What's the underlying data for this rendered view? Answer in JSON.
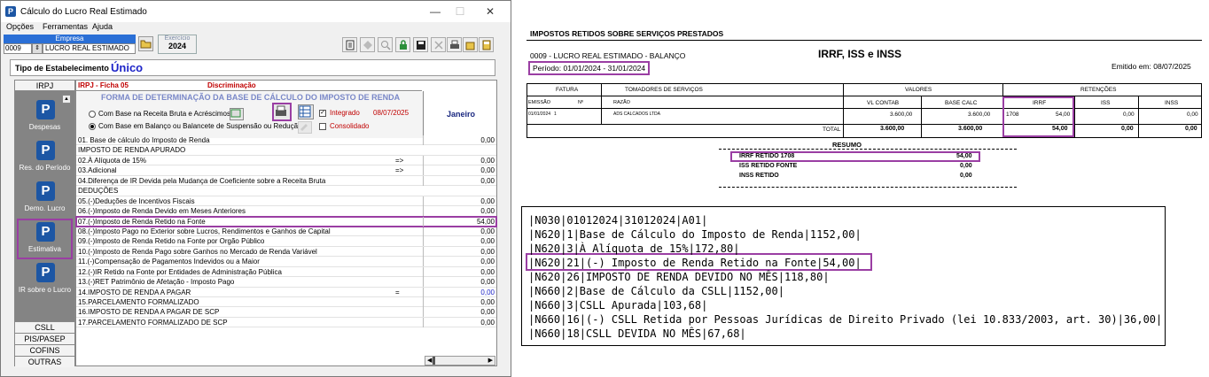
{
  "window": {
    "title": "Cálculo do Lucro Real Estimado",
    "controls": [
      "—",
      "☐",
      "✕"
    ]
  },
  "menu": [
    "Opções",
    "Ferramentas",
    "Ajuda"
  ],
  "empresa": {
    "label": "Empresa",
    "code": "0009",
    "name": "LUCRO REAL ESTIMADO"
  },
  "exercicio": {
    "label": "Exercício",
    "value": "2024"
  },
  "tipo": {
    "label": "Tipo de Estabelecimento",
    "value": "Único"
  },
  "sidebar": {
    "header": "IRPJ",
    "items": [
      {
        "label": "Despesas"
      },
      {
        "label": "Res. do Período"
      },
      {
        "label": "Demo. Lucro"
      },
      {
        "label": "Estimativa"
      },
      {
        "label": "IR sobre o Lucro"
      }
    ],
    "bottom": [
      "CSLL",
      "PIS/PASEP",
      "COFINS",
      "OUTRAS"
    ]
  },
  "main": {
    "ficha": "IRPJ - Ficha 05",
    "discriminacao": "Discriminação",
    "forma_title": "FORMA DE DETERMINAÇÃO DA BASE DE CÁLCULO DO IMPOSTO DE RENDA",
    "opt1": "Com Base na  Receita Bruta e Acréscimos",
    "opt2": "Com Base em Balanço ou Balancete de Suspensão ou Redução",
    "integrado": "Integrado",
    "date": "08/07/2025",
    "consolidado": "Consolidado",
    "month": "Janeiro",
    "rows": [
      {
        "label": "01. Base de cálculo do Imposto de Renda",
        "mark": "",
        "value": "0,00"
      },
      {
        "label": "IMPOSTO DE RENDA APURADO",
        "mark": "",
        "value": ""
      },
      {
        "label": "   02.À  Alíquota de 15%",
        "mark": "=>",
        "value": "0,00"
      },
      {
        "label": "   03.Adicional",
        "mark": "=>",
        "value": "0,00"
      },
      {
        "label": "   04.Diferença de IR Devida pela Mudança de Coeficiente sobre a Receita Bruta",
        "mark": "",
        "value": "0,00"
      },
      {
        "label": "DEDUÇÕES",
        "mark": "",
        "value": ""
      },
      {
        "label": "   05.(-)Deduções de Incentivos Fiscais",
        "mark": "",
        "value": "0,00"
      },
      {
        "label": "   06.(-)Imposto de Renda Devido em Meses Anteriores",
        "mark": "",
        "value": "0,00"
      },
      {
        "label": "   07.(-)Imposto de Renda Retido na Fonte",
        "mark": "",
        "value": "54,00"
      },
      {
        "label": "   08.(-)Imposto Pago no Exterior sobre Lucros, Rendimentos e Ganhos de Capital",
        "mark": "",
        "value": "0,00"
      },
      {
        "label": "   09.(-)Imposto de Renda Retido na Fonte por Orgão Público",
        "mark": "",
        "value": "0,00"
      },
      {
        "label": "   10.(-)Imposto de Renda Pago sobre Ganhos no Mercado de Renda Variável",
        "mark": "",
        "value": "0,00"
      },
      {
        "label": "   11.(-)Compensação de Pagamentos Indevidos ou a Maior",
        "mark": "",
        "value": "0,00"
      },
      {
        "label": "   12.(-)IR Retido na Fonte por Entidades de Administração Pública",
        "mark": "",
        "value": "0,00"
      },
      {
        "label": "   13.(-)RET Patrimônio de Afetação - Imposto Pago",
        "mark": "",
        "value": "0,00"
      },
      {
        "label": "14.IMPOSTO DE RENDA A PAGAR",
        "mark": "=",
        "value": "0,00"
      },
      {
        "label": "15.PARCELAMENTO FORMALIZADO",
        "mark": "",
        "value": "0,00"
      },
      {
        "label": "16.IMPOSTO DE RENDA A PAGAR DE SCP",
        "mark": "",
        "value": "0,00"
      },
      {
        "label": "17.PARCELAMENTO FORMALIZADO DE SCP",
        "mark": "",
        "value": "0,00"
      }
    ]
  },
  "report": {
    "title": "IMPOSTOS RETIDOS SOBRE SERVIÇOS PRESTADOS",
    "company": "0009 - LUCRO REAL ESTIMADO - BALANÇO",
    "periodo": "Período: 01/01/2024 - 31/01/2024",
    "heading": "IRRF, ISS e INSS",
    "emitido": "Emitido em: 08/07/2025",
    "groups": {
      "fatura": "FATURA",
      "tomadores": "TOMADORES DE SERVIÇOS",
      "valores": "VALORES",
      "retencoes": "RETENÇÕES"
    },
    "cols": {
      "emissao": "EMISSÃO",
      "num": "Nº",
      "razao": "RAZÃO",
      "vl_contab": "VL CONTAB",
      "base_calc": "BASE CALC",
      "irrf": "IRRF",
      "iss": "ISS",
      "inss": "INSS"
    },
    "line": {
      "emissao": "01/01/2024",
      "num": "1",
      "razao": "ADS CALCADOS LTDA",
      "vl_contab": "3.600,00",
      "base_calc": "3.600,00",
      "irrf_code": "1708",
      "irrf": "54,00",
      "iss": "0,00",
      "inss": "0,00"
    },
    "total": {
      "label": "TOTAL",
      "vl_contab": "3.600,00",
      "base_calc": "3.600,00",
      "irrf": "54,00",
      "iss": "0,00",
      "inss": "0,00"
    },
    "resumo": {
      "title": "RESUMO",
      "items": [
        {
          "label": "IRRF RETIDO 1708",
          "value": "54,00"
        },
        {
          "label": "ISS RETIDO FONTE",
          "value": "0,00"
        },
        {
          "label": "INSS RETIDO",
          "value": "0,00"
        }
      ]
    }
  },
  "sped": {
    "lines": [
      "|N030|01012024|31012024|A01|",
      "|N620|1|Base de Cálculo do Imposto de Renda|1152,00|",
      "|N620|3|À Alíquota de 15%|172,80|",
      "|N620|21|(-) Imposto de Renda Retido na Fonte|54,00|",
      "|N620|26|IMPOSTO DE RENDA DEVIDO NO MÊS|118,80|",
      "|N660|2|Base de Cálculo da CSLL|1152,00|",
      "|N660|3|CSLL Apurada|103,68|",
      "|N660|16|(-) CSLL Retida por Pessoas Jurídicas de Direito Privado (lei 10.833/2003, art. 30)|36,00|",
      "|N660|18|CSLL DEVIDA NO MÊS|67,68|"
    ]
  },
  "colors": {
    "highlight": "#9a3ea3",
    "accent_red": "#c00000",
    "brand_blue": "#1c56a4"
  }
}
